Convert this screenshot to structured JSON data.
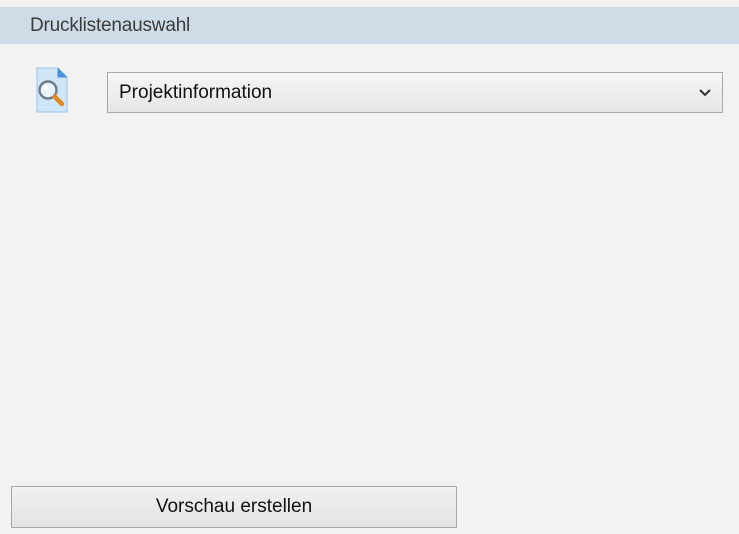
{
  "panel": {
    "title": "Drucklistenauswahl",
    "icon": "document-preview-magnifier-icon"
  },
  "report_select": {
    "selected": "Projektinformation",
    "dropdown_icon": "chevron-down-icon"
  },
  "actions": {
    "preview_label": "Vorschau erstellen"
  },
  "colors": {
    "header_bg": "#cfdbe6",
    "panel_bg": "#f2f2f2",
    "border": "#a9a9a9"
  }
}
